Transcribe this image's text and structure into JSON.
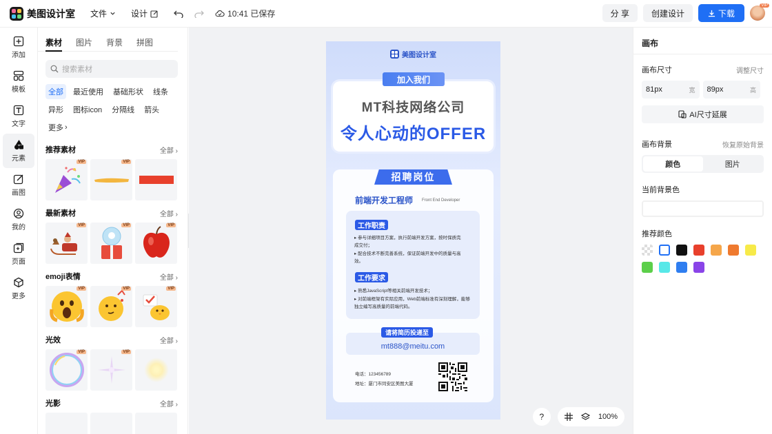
{
  "app": {
    "name": "美图设计室"
  },
  "topbar": {
    "file_label": "文件",
    "design_label": "设计",
    "save_status": "10:41 已保存",
    "share_label": "分 享",
    "create_label": "创建设计",
    "download_label": "下载",
    "avatar_badge": "VIP"
  },
  "leftbar": {
    "items": [
      {
        "label": "添加",
        "icon": "plus-square-icon"
      },
      {
        "label": "模板",
        "icon": "template-icon"
      },
      {
        "label": "文字",
        "icon": "text-icon"
      },
      {
        "label": "元素",
        "icon": "shapes-icon"
      },
      {
        "label": "画图",
        "icon": "draw-icon"
      },
      {
        "label": "我的",
        "icon": "user-icon"
      },
      {
        "label": "页面",
        "icon": "page-icon"
      },
      {
        "label": "更多",
        "icon": "cube-icon"
      }
    ]
  },
  "panel": {
    "tabs": [
      "素材",
      "图片",
      "背景",
      "拼图"
    ],
    "search_placeholder": "搜索素材",
    "filters": [
      "全部",
      "最近使用",
      "基础形状",
      "线条",
      "异形",
      "图标icon",
      "分隔线",
      "箭头",
      "更多"
    ],
    "sections": [
      {
        "title": "推荐素材",
        "all": "全部"
      },
      {
        "title": "最新素材",
        "all": "全部"
      },
      {
        "title": "emoji表情",
        "all": "全部"
      },
      {
        "title": "光效",
        "all": "全部"
      },
      {
        "title": "光影",
        "all": "全部"
      }
    ],
    "vip": "VIP"
  },
  "poster": {
    "brand": "美图设计室",
    "join": "加入我们",
    "company": "MT科技网络公司",
    "offer": "令人心动的OFFER",
    "positions": "招聘岗位",
    "role": "前端开发工程师",
    "role_en": "Front End Developer",
    "duty_title": "工作职责",
    "duty_lines": [
      "▸ 参与详细项目方案，执行前端开发方案，按时保质完",
      "  成交付；",
      "▸ 配合技术不断完善系统，保证前端开发中的质量与高",
      "  效。"
    ],
    "req_title": "工作要求",
    "req_lines": [
      "▸ 熟悉JavaScript等相关前端开发技术；",
      "▸ 对前端框架有实际应用，Web前端标准有深刻理解，能够",
      "  独立编写高质量的前端代码。"
    ],
    "apply": "请将简历投递至",
    "email": "mt888@meitu.com",
    "phone": "电话：123456789",
    "address": "地址：厦门市同安区美图大厦"
  },
  "canvas_tools": {
    "help": "?",
    "zoom": "100%"
  },
  "right": {
    "title": "画布",
    "size_label": "画布尺寸",
    "adjust_label": "调整尺寸",
    "width_value": "81px",
    "width_unit": "宽",
    "height_value": "89px",
    "height_unit": "高",
    "ai_label": "AI尺寸延展",
    "bg_label": "画布背景",
    "restore_label": "恢复原始背景",
    "seg_color": "颜色",
    "seg_image": "图片",
    "current_label": "当前背景色",
    "recommend_label": "推荐颜色",
    "swatches": [
      "transparent",
      "#ffffff",
      "#111111",
      "#e8402c",
      "#f5a64a",
      "#ef7a2f",
      "#f7ea49",
      "#5ccf4a",
      "#58e8e8",
      "#2f7ef0",
      "#8a44e8"
    ]
  }
}
